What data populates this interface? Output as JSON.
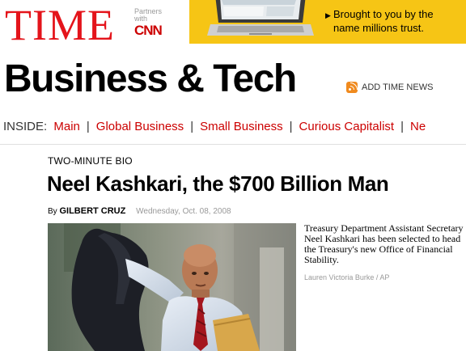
{
  "masthead": {
    "logo": "TIME",
    "partners_line1": "Partners",
    "partners_line2": "with",
    "partner_name": "CNN"
  },
  "ad": {
    "line1": "Brought to you by the",
    "line2": "name millions trust.",
    "arrow_icon": "triangle-right-icon",
    "background": "#f6c515"
  },
  "section": {
    "title": "Business & Tech",
    "feed_link": "ADD TIME NEWS",
    "feed_icon": "rss-icon"
  },
  "nav": {
    "label": "INSIDE:",
    "separator": "|",
    "items": [
      {
        "label": "Main"
      },
      {
        "label": "Global Business"
      },
      {
        "label": "Small Business"
      },
      {
        "label": "Curious Capitalist"
      },
      {
        "label": "Ne"
      }
    ],
    "link_color": "#cc0000"
  },
  "article": {
    "kicker": "TWO-MINUTE BIO",
    "headline": "Neel Kashkari, the $700 Billion Man",
    "by": "By",
    "author": "GILBERT CRUZ",
    "date": "Wednesday, Oct. 08, 2008",
    "caption": "Treasury Department Assistant Secretary Neel Kashkari has been selected to head the Treasury's new Office of Financial Stability.",
    "credit": "Lauren Victoria Burke / AP"
  },
  "colors": {
    "brand_red": "#e4141b",
    "link_red": "#cc0000"
  }
}
